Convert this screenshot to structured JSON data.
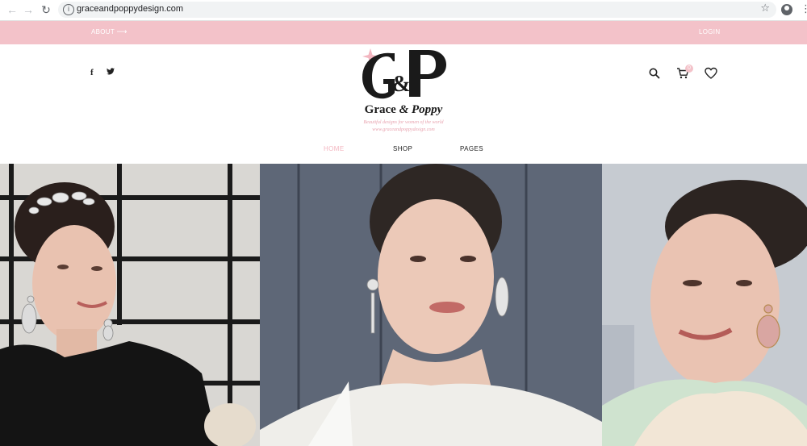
{
  "browser": {
    "url": "graceandpoppydesign.com",
    "back_icon": "back-arrow-icon",
    "forward_icon": "forward-arrow-icon",
    "reload_icon": "reload-icon",
    "info_icon": "info-icon",
    "bookmark_icon": "star-icon",
    "account_icon": "account-icon",
    "menu_icon": "kebab-menu-icon"
  },
  "topbar": {
    "about_label": "ABOUT",
    "login_label": "LOGIN",
    "bg_color": "#f3c2c9"
  },
  "social": {
    "facebook": "f",
    "twitter": "twitter-icon"
  },
  "logo": {
    "monogram": "G&P",
    "name_part1": "Grace",
    "name_amp": "&",
    "name_part2": "Poppy",
    "tagline_1": "Beautiful designs for women of the world",
    "tagline_2": "www.graceandpoppydesign.com",
    "accent_color": "#f3b6c0"
  },
  "header_icons": {
    "cart_count": "0"
  },
  "nav": {
    "home": "HOME",
    "shop": "SHOP",
    "pages": "PAGES"
  },
  "hero": {
    "panels": [
      "model-with-hair-tiara",
      "model-in-white-dress",
      "model-with-pink-earrings"
    ]
  }
}
